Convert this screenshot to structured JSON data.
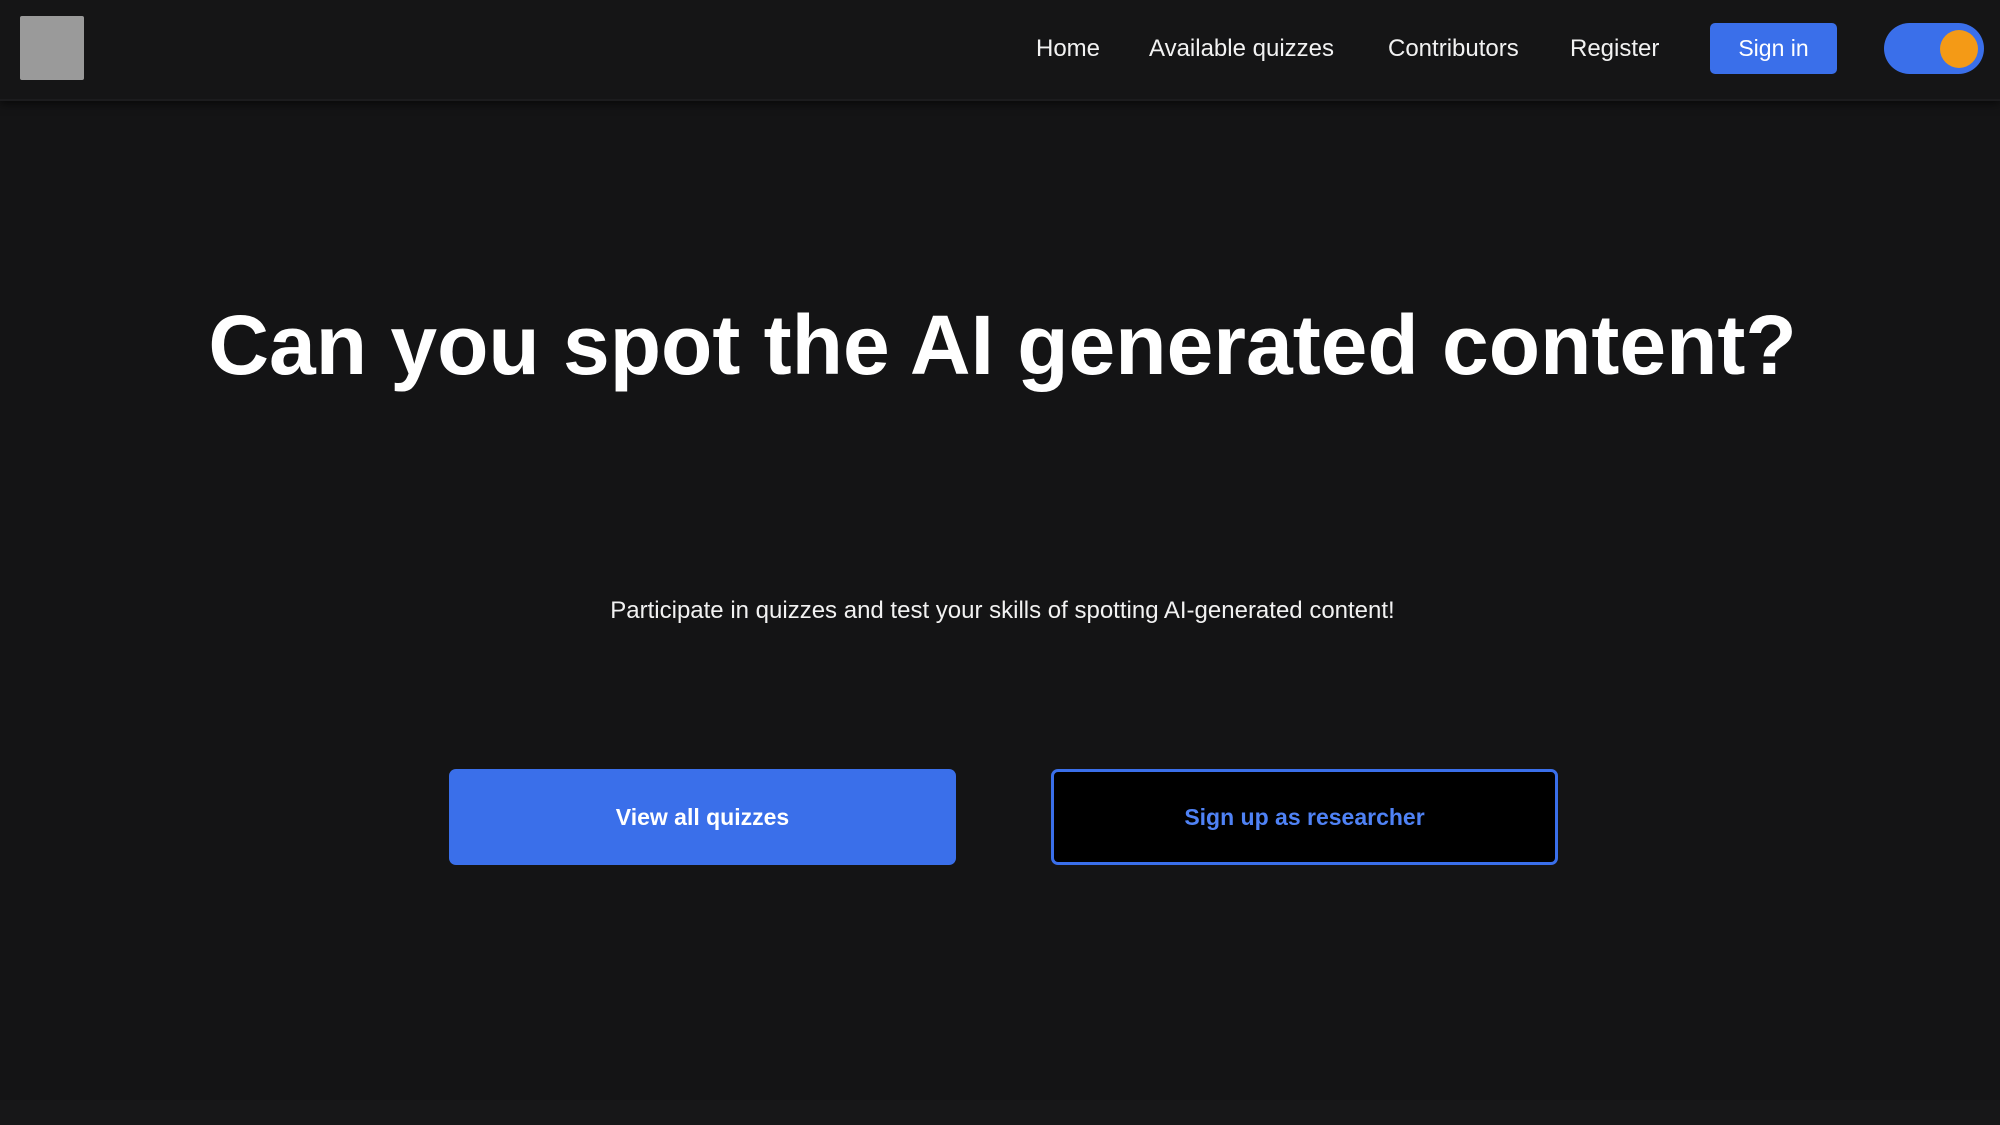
{
  "nav": {
    "logo": "logo",
    "links": [
      "Home",
      "Available quizzes",
      "Contributors",
      "Register"
    ],
    "signin_label": "Sign in",
    "theme_toggle": {
      "state": "on",
      "knob_color": "#f49a16"
    }
  },
  "hero": {
    "title": "Can you spot the AI generated content?",
    "subtitle": "Participate in quizzes and test your skills of spotting AI-generated content!",
    "primary_label": "View all quizzes",
    "secondary_label": "Sign up as researcher"
  },
  "colors": {
    "background": "#141415",
    "accent": "#3a6fea",
    "accent_text": "#4f82f5",
    "toggle_knob": "#f49a16"
  }
}
